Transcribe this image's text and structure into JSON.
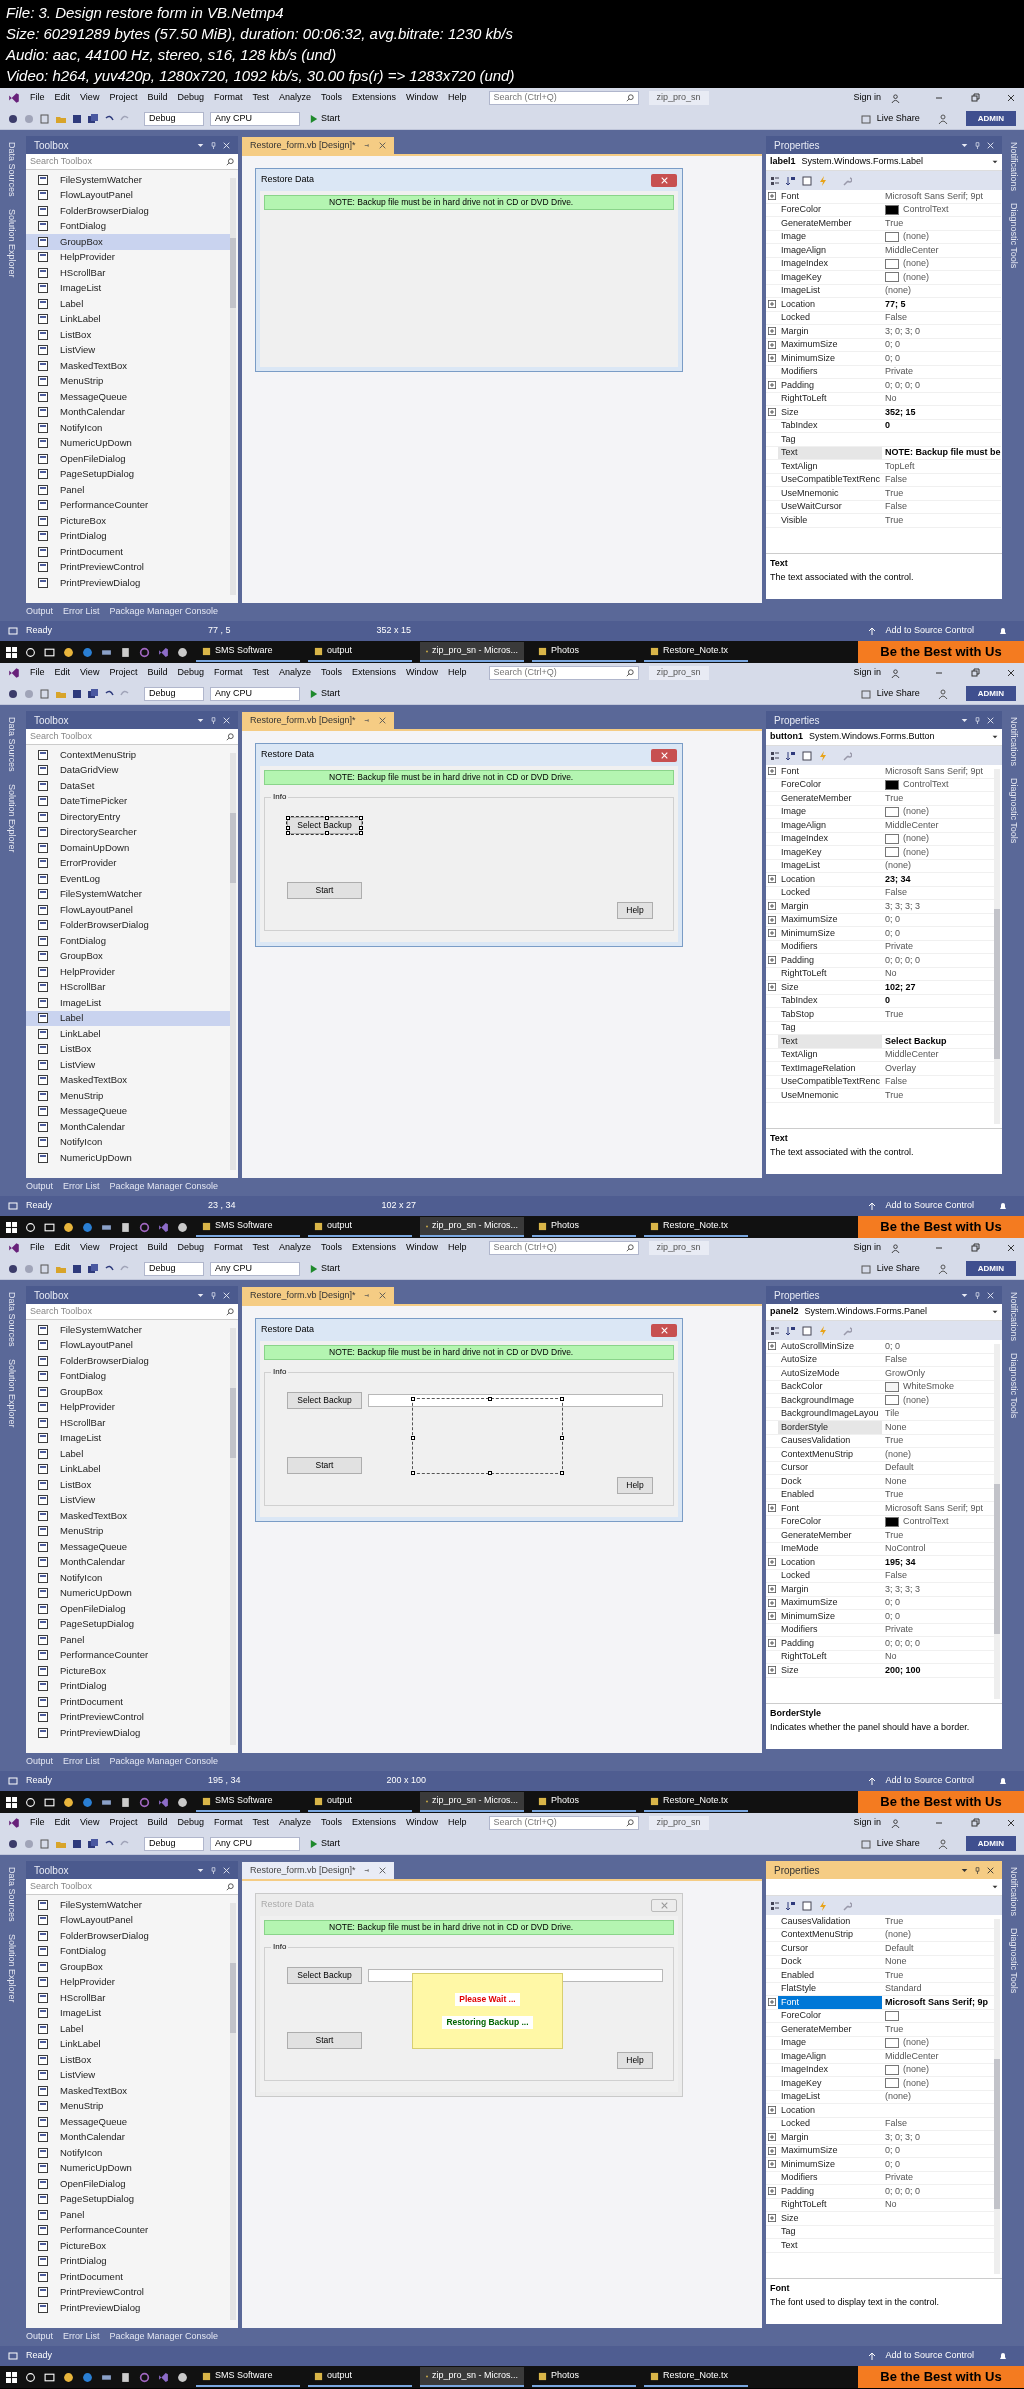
{
  "header": {
    "lines": [
      "File: 3. Design restore form in VB.Netmp4",
      "Size: 60291289 bytes (57.50 MiB), duration: 00:06:32, avg.bitrate: 1230 kb/s",
      "Audio: aac, 44100 Hz, stereo, s16, 128 kb/s (und)",
      "Video: h264, yuv420p, 1280x720, 1092 kb/s, 30.00 fps(r) => 1283x720 (und)"
    ]
  },
  "frames": [
    {
      "menu": [
        "File",
        "Edit",
        "View",
        "Project",
        "Build",
        "Debug",
        "Format",
        "Test",
        "Analyze",
        "Tools",
        "Extensions",
        "Window",
        "Help"
      ],
      "search_placeholder": "Search (Ctrl+Q)",
      "solution": "zip_pro_sn",
      "sign_in": "Sign in",
      "toolbar": {
        "config": "Debug",
        "platform": "Any CPU",
        "run": "Start",
        "live_share": "Live Share",
        "user": "ADMIN"
      },
      "left_tabs": [
        "Data Sources",
        "Solution Explorer"
      ],
      "right_tabs": [
        "Notifications",
        "Diagnostic Tools"
      ],
      "toolbox": {
        "title": "Toolbox",
        "search_placeholder": "Search Toolbox",
        "items": [
          {
            "label": "FileSystemWatcher",
            "selected": false
          },
          {
            "label": "FlowLayoutPanel",
            "selected": false
          },
          {
            "label": "FolderBrowserDialog",
            "selected": false
          },
          {
            "label": "FontDialog",
            "selected": false
          },
          {
            "label": "GroupBox",
            "selected": true
          },
          {
            "label": "HelpProvider",
            "selected": false
          },
          {
            "label": "HScrollBar",
            "selected": false
          },
          {
            "label": "ImageList",
            "selected": false
          },
          {
            "label": "Label",
            "selected": false
          },
          {
            "label": "LinkLabel",
            "selected": false
          },
          {
            "label": "ListBox",
            "selected": false
          },
          {
            "label": "ListView",
            "selected": false
          },
          {
            "label": "MaskedTextBox",
            "selected": false
          },
          {
            "label": "MenuStrip",
            "selected": false
          },
          {
            "label": "MessageQueue",
            "selected": false
          },
          {
            "label": "MonthCalendar",
            "selected": false
          },
          {
            "label": "NotifyIcon",
            "selected": false
          },
          {
            "label": "NumericUpDown",
            "selected": false
          },
          {
            "label": "OpenFileDialog",
            "selected": false
          },
          {
            "label": "PageSetupDialog",
            "selected": false
          },
          {
            "label": "Panel",
            "selected": false
          },
          {
            "label": "PerformanceCounter",
            "selected": false
          },
          {
            "label": "PictureBox",
            "selected": false
          },
          {
            "label": "PrintDialog",
            "selected": false
          },
          {
            "label": "PrintDocument",
            "selected": false
          },
          {
            "label": "PrintPreviewControl",
            "selected": false
          },
          {
            "label": "PrintPreviewDialog",
            "selected": false
          }
        ]
      },
      "document_tab": {
        "label": "Restore_form.vb [Design]*",
        "active": true
      },
      "form": {
        "title": "Restore Data",
        "active": true,
        "note": "NOTE: Backup file must be in hard drive not in CD or DVD Drive."
      },
      "properties": {
        "title": "Properties",
        "active": false,
        "object_name": "label1",
        "object_type": "System.Windows.Forms.Label",
        "rows": [
          {
            "name": "Font",
            "value": "Microsoft Sans Serif; 9pt",
            "expandable": true,
            "bold": false,
            "selected": false
          },
          {
            "name": "ForeColor",
            "value": "ControlText",
            "color": "#000000",
            "expandable": false,
            "bold": false,
            "selected": false
          },
          {
            "name": "GenerateMember",
            "value": "True",
            "expandable": false,
            "bold": false,
            "selected": false
          },
          {
            "name": "Image",
            "value": "(none)",
            "color": "#ffffff",
            "expandable": false,
            "bold": false,
            "selected": false
          },
          {
            "name": "ImageAlign",
            "value": "MiddleCenter",
            "expandable": false,
            "bold": false,
            "selected": false
          },
          {
            "name": "ImageIndex",
            "value": "(none)",
            "color": "#ffffff",
            "expandable": false,
            "bold": false,
            "selected": false
          },
          {
            "name": "ImageKey",
            "value": "(none)",
            "color": "#ffffff",
            "expandable": false,
            "bold": false,
            "selected": false
          },
          {
            "name": "ImageList",
            "value": "(none)",
            "expandable": false,
            "bold": false,
            "selected": false
          },
          {
            "name": "Location",
            "value": "77; 5",
            "expandable": true,
            "bold": true,
            "selected": false
          },
          {
            "name": "Locked",
            "value": "False",
            "expandable": false,
            "bold": false,
            "selected": false
          },
          {
            "name": "Margin",
            "value": "3; 0; 3; 0",
            "expandable": true,
            "bold": false,
            "selected": false
          },
          {
            "name": "MaximumSize",
            "value": "0; 0",
            "expandable": true,
            "bold": false,
            "selected": false
          },
          {
            "name": "MinimumSize",
            "value": "0; 0",
            "expandable": true,
            "bold": false,
            "selected": false
          },
          {
            "name": "Modifiers",
            "value": "Private",
            "expandable": false,
            "bold": false,
            "selected": false
          },
          {
            "name": "Padding",
            "value": "0; 0; 0; 0",
            "expandable": true,
            "bold": false,
            "selected": false
          },
          {
            "name": "RightToLeft",
            "value": "No",
            "expandable": false,
            "bold": false,
            "selected": false
          },
          {
            "name": "Size",
            "value": "352; 15",
            "expandable": true,
            "bold": true,
            "selected": false
          },
          {
            "name": "TabIndex",
            "value": "0",
            "expandable": false,
            "bold": true,
            "selected": false
          },
          {
            "name": "Tag",
            "expandable": false,
            "selected": false
          },
          {
            "name": "Text",
            "value": "NOTE: Backup file must be",
            "expandable": false,
            "bold": true,
            "selected": true
          },
          {
            "name": "TextAlign",
            "value": "TopLeft",
            "expandable": false,
            "bold": false,
            "selected": false
          },
          {
            "name": "UseCompatibleTextRenc",
            "value": "False",
            "expandable": false,
            "bold": false,
            "selected": false
          },
          {
            "name": "UseMnemonic",
            "value": "True",
            "expandable": false,
            "bold": false,
            "selected": false
          },
          {
            "name": "UseWaitCursor",
            "value": "False",
            "expandable": false,
            "bold": false,
            "selected": false
          },
          {
            "name": "Visible",
            "value": "True",
            "expandable": false,
            "bold": false,
            "selected": false
          }
        ],
        "description_title": "Text",
        "description": "The text associated with the control."
      },
      "bottom_tabs": [
        "Output",
        "Error List",
        "Package Manager Console"
      ],
      "status": {
        "text": "Ready",
        "position": "77 , 5",
        "size": "352 x 15",
        "source_control": "Add to Source Control"
      },
      "taskbar": [
        {
          "label": "SMS Software",
          "selected": false
        },
        {
          "label": "output",
          "selected": false
        },
        {
          "label": "zip_pro_sn - Micros...",
          "selected": true
        },
        {
          "label": "Photos",
          "selected": false
        },
        {
          "label": "Restore_Note.tx",
          "selected": false
        }
      ],
      "banner": "Be the Best with Us"
    },
    {
      "menu": [
        "File",
        "Edit",
        "View",
        "Project",
        "Build",
        "Debug",
        "Format",
        "Test",
        "Analyze",
        "Tools",
        "Extensions",
        "Window",
        "Help"
      ],
      "search_placeholder": "Search (Ctrl+Q)",
      "solution": "zip_pro_sn",
      "sign_in": "Sign in",
      "toolbar": {
        "config": "Debug",
        "platform": "Any CPU",
        "run": "Start",
        "live_share": "Live Share",
        "user": "ADMIN"
      },
      "left_tabs": [
        "Data Sources",
        "Solution Explorer"
      ],
      "right_tabs": [
        "Notifications",
        "Diagnostic Tools"
      ],
      "toolbox": {
        "title": "Toolbox",
        "search_placeholder": "Search Toolbox",
        "items": [
          {
            "label": "ContextMenuStrip",
            "selected": false
          },
          {
            "label": "DataGridView",
            "selected": false
          },
          {
            "label": "DataSet",
            "selected": false
          },
          {
            "label": "DateTimePicker",
            "selected": false
          },
          {
            "label": "DirectoryEntry",
            "selected": false
          },
          {
            "label": "DirectorySearcher",
            "selected": false
          },
          {
            "label": "DomainUpDown",
            "selected": false
          },
          {
            "label": "ErrorProvider",
            "selected": false
          },
          {
            "label": "EventLog",
            "selected": false
          },
          {
            "label": "FileSystemWatcher",
            "selected": false
          },
          {
            "label": "FlowLayoutPanel",
            "selected": false
          },
          {
            "label": "FolderBrowserDialog",
            "selected": false
          },
          {
            "label": "FontDialog",
            "selected": false
          },
          {
            "label": "GroupBox",
            "selected": false
          },
          {
            "label": "HelpProvider",
            "selected": false
          },
          {
            "label": "HScrollBar",
            "selected": false
          },
          {
            "label": "ImageList",
            "selected": false
          },
          {
            "label": "Label",
            "selected": true
          },
          {
            "label": "LinkLabel",
            "selected": false
          },
          {
            "label": "ListBox",
            "selected": false
          },
          {
            "label": "ListView",
            "selected": false
          },
          {
            "label": "MaskedTextBox",
            "selected": false
          },
          {
            "label": "MenuStrip",
            "selected": false
          },
          {
            "label": "MessageQueue",
            "selected": false
          },
          {
            "label": "MonthCalendar",
            "selected": false
          },
          {
            "label": "NotifyIcon",
            "selected": false
          },
          {
            "label": "NumericUpDown",
            "selected": false
          }
        ]
      },
      "document_tab": {
        "label": "Restore_form.vb [Design]*",
        "active": true
      },
      "form": {
        "title": "Restore Data",
        "active": true,
        "note": "NOTE: Backup file must be in hard drive not in CD or DVD Drive.",
        "group": "Info",
        "select_button": {
          "label": "Select Backup",
          "selected": true
        },
        "start_button": "Start",
        "help_button": "Help"
      },
      "properties": {
        "title": "Properties",
        "active": false,
        "object_name": "button1",
        "object_type": "System.Windows.Forms.Button",
        "rows": [
          {
            "name": "Font",
            "value": "Microsoft Sans Serif; 9pt",
            "expandable": true,
            "bold": false,
            "selected": false
          },
          {
            "name": "ForeColor",
            "value": "ControlText",
            "color": "#000000",
            "expandable": false,
            "bold": false,
            "selected": false
          },
          {
            "name": "GenerateMember",
            "value": "True",
            "expandable": false,
            "bold": false,
            "selected": false
          },
          {
            "name": "Image",
            "value": "(none)",
            "color": "#ffffff",
            "expandable": false,
            "bold": false,
            "selected": false
          },
          {
            "name": "ImageAlign",
            "value": "MiddleCenter",
            "expandable": false,
            "bold": false,
            "selected": false
          },
          {
            "name": "ImageIndex",
            "value": "(none)",
            "color": "#ffffff",
            "expandable": false,
            "bold": false,
            "selected": false
          },
          {
            "name": "ImageKey",
            "value": "(none)",
            "color": "#ffffff",
            "expandable": false,
            "bold": false,
            "selected": false
          },
          {
            "name": "ImageList",
            "value": "(none)",
            "expandable": false,
            "bold": false,
            "selected": false
          },
          {
            "name": "Location",
            "value": "23; 34",
            "expandable": true,
            "bold": true,
            "selected": false
          },
          {
            "name": "Locked",
            "value": "False",
            "expandable": false,
            "bold": false,
            "selected": false
          },
          {
            "name": "Margin",
            "value": "3; 3; 3; 3",
            "expandable": true,
            "bold": false,
            "selected": false
          },
          {
            "name": "MaximumSize",
            "value": "0; 0",
            "expandable": true,
            "bold": false,
            "selected": false
          },
          {
            "name": "MinimumSize",
            "value": "0; 0",
            "expandable": true,
            "bold": false,
            "selected": false
          },
          {
            "name": "Modifiers",
            "value": "Private",
            "expandable": false,
            "bold": false,
            "selected": false
          },
          {
            "name": "Padding",
            "value": "0; 0; 0; 0",
            "expandable": true,
            "bold": false,
            "selected": false
          },
          {
            "name": "RightToLeft",
            "value": "No",
            "expandable": false,
            "bold": false,
            "selected": false
          },
          {
            "name": "Size",
            "value": "102; 27",
            "expandable": true,
            "bold": true,
            "selected": false
          },
          {
            "name": "TabIndex",
            "value": "0",
            "expandable": false,
            "bold": true,
            "selected": false
          },
          {
            "name": "TabStop",
            "value": "True",
            "expandable": false,
            "bold": false,
            "selected": false
          },
          {
            "name": "Tag",
            "expandable": false,
            "selected": false
          },
          {
            "name": "Text",
            "value": "Select Backup",
            "expandable": false,
            "bold": true,
            "selected": true
          },
          {
            "name": "TextAlign",
            "value": "MiddleCenter",
            "expandable": false,
            "bold": false,
            "selected": false
          },
          {
            "name": "TextImageRelation",
            "value": "Overlay",
            "expandable": false,
            "bold": false,
            "selected": false
          },
          {
            "name": "UseCompatibleTextRenc",
            "value": "False",
            "expandable": false,
            "bold": false,
            "selected": false
          },
          {
            "name": "UseMnemonic",
            "value": "True",
            "expandable": false,
            "bold": false,
            "selected": false
          }
        ],
        "description_title": "Text",
        "description": "The text associated with the control."
      },
      "bottom_tabs": [
        "Output",
        "Error List",
        "Package Manager Console"
      ],
      "status": {
        "text": "Ready",
        "position": "23 , 34",
        "size": "102 x 27",
        "source_control": "Add to Source Control"
      },
      "taskbar": [
        {
          "label": "SMS Software",
          "selected": false
        },
        {
          "label": "output",
          "selected": false
        },
        {
          "label": "zip_pro_sn - Micros...",
          "selected": true
        },
        {
          "label": "Photos",
          "selected": false
        },
        {
          "label": "Restore_Note.tx",
          "selected": false
        }
      ],
      "banner": "Be the Best with Us"
    },
    {
      "menu": [
        "File",
        "Edit",
        "View",
        "Project",
        "Build",
        "Debug",
        "Format",
        "Test",
        "Analyze",
        "Tools",
        "Extensions",
        "Window",
        "Help"
      ],
      "search_placeholder": "Search (Ctrl+Q)",
      "solution": "zip_pro_sn",
      "sign_in": "Sign in",
      "toolbar": {
        "config": "Debug",
        "platform": "Any CPU",
        "run": "Start",
        "live_share": "Live Share",
        "user": "ADMIN"
      },
      "left_tabs": [
        "Data Sources",
        "Solution Explorer"
      ],
      "right_tabs": [
        "Notifications",
        "Diagnostic Tools"
      ],
      "toolbox": {
        "title": "Toolbox",
        "search_placeholder": "Search Toolbox",
        "items": [
          {
            "label": "FileSystemWatcher",
            "selected": false
          },
          {
            "label": "FlowLayoutPanel",
            "selected": false
          },
          {
            "label": "FolderBrowserDialog",
            "selected": false
          },
          {
            "label": "FontDialog",
            "selected": false
          },
          {
            "label": "GroupBox",
            "selected": false
          },
          {
            "label": "HelpProvider",
            "selected": false
          },
          {
            "label": "HScrollBar",
            "selected": false
          },
          {
            "label": "ImageList",
            "selected": false
          },
          {
            "label": "Label",
            "selected": false
          },
          {
            "label": "LinkLabel",
            "selected": false
          },
          {
            "label": "ListBox",
            "selected": false
          },
          {
            "label": "ListView",
            "selected": false
          },
          {
            "label": "MaskedTextBox",
            "selected": false
          },
          {
            "label": "MenuStrip",
            "selected": false
          },
          {
            "label": "MessageQueue",
            "selected": false
          },
          {
            "label": "MonthCalendar",
            "selected": false
          },
          {
            "label": "NotifyIcon",
            "selected": false
          },
          {
            "label": "NumericUpDown",
            "selected": false
          },
          {
            "label": "OpenFileDialog",
            "selected": false
          },
          {
            "label": "PageSetupDialog",
            "selected": false
          },
          {
            "label": "Panel",
            "selected": false
          },
          {
            "label": "PerformanceCounter",
            "selected": false
          },
          {
            "label": "PictureBox",
            "selected": false
          },
          {
            "label": "PrintDialog",
            "selected": false
          },
          {
            "label": "PrintDocument",
            "selected": false
          },
          {
            "label": "PrintPreviewControl",
            "selected": false
          },
          {
            "label": "PrintPreviewDialog",
            "selected": false
          }
        ]
      },
      "document_tab": {
        "label": "Restore_form.vb [Design]*",
        "active": true
      },
      "form": {
        "title": "Restore Data",
        "active": true,
        "note": "NOTE: Backup file must be in hard drive not in CD or DVD Drive.",
        "group": "Info",
        "select_button": {
          "label": "Select Backup",
          "selected": false
        },
        "textbox": true,
        "panel": {
          "selected": true
        },
        "start_button": "Start",
        "help_button": "Help"
      },
      "properties": {
        "title": "Properties",
        "active": false,
        "object_name": "panel2",
        "object_type": "System.Windows.Forms.Panel",
        "rows": [
          {
            "name": "AutoScrollMinSize",
            "value": "0; 0",
            "expandable": true,
            "bold": false,
            "selected": false
          },
          {
            "name": "AutoSize",
            "value": "False",
            "expandable": false,
            "bold": false,
            "selected": false
          },
          {
            "name": "AutoSizeMode",
            "value": "GrowOnly",
            "expandable": false,
            "bold": false,
            "selected": false
          },
          {
            "name": "BackColor",
            "value": "WhiteSmoke",
            "color": "#f5f5f5",
            "expandable": false,
            "bold": false,
            "selected": false
          },
          {
            "name": "BackgroundImage",
            "value": "(none)",
            "color": "#ffffff",
            "expandable": false,
            "bold": false,
            "selected": false
          },
          {
            "name": "BackgroundImageLayou",
            "value": "Tile",
            "expandable": false,
            "bold": false,
            "selected": false
          },
          {
            "name": "BorderStyle",
            "value": "None",
            "expandable": false,
            "bold": false,
            "selected": true
          },
          {
            "name": "CausesValidation",
            "value": "True",
            "expandable": false,
            "bold": false,
            "selected": false
          },
          {
            "name": "ContextMenuStrip",
            "value": "(none)",
            "expandable": false,
            "bold": false,
            "selected": false
          },
          {
            "name": "Cursor",
            "value": "Default",
            "expandable": false,
            "bold": false,
            "selected": false
          },
          {
            "name": "Dock",
            "value": "None",
            "expandable": false,
            "bold": false,
            "selected": false
          },
          {
            "name": "Enabled",
            "value": "True",
            "expandable": false,
            "bold": false,
            "selected": false
          },
          {
            "name": "Font",
            "value": "Microsoft Sans Serif; 9pt",
            "expandable": true,
            "bold": false,
            "selected": false
          },
          {
            "name": "ForeColor",
            "value": "ControlText",
            "color": "#000000",
            "expandable": false,
            "bold": false,
            "selected": false
          },
          {
            "name": "GenerateMember",
            "value": "True",
            "expandable": false,
            "bold": false,
            "selected": false
          },
          {
            "name": "ImeMode",
            "value": "NoControl",
            "expandable": false,
            "bold": false,
            "selected": false
          },
          {
            "name": "Location",
            "value": "195; 34",
            "expandable": true,
            "bold": true,
            "selected": false
          },
          {
            "name": "Locked",
            "value": "False",
            "expandable": false,
            "bold": false,
            "selected": false
          },
          {
            "name": "Margin",
            "value": "3; 3; 3; 3",
            "expandable": true,
            "bold": false,
            "selected": false
          },
          {
            "name": "MaximumSize",
            "value": "0; 0",
            "expandable": true,
            "bold": false,
            "selected": false
          },
          {
            "name": "MinimumSize",
            "value": "0; 0",
            "expandable": true,
            "bold": false,
            "selected": false
          },
          {
            "name": "Modifiers",
            "value": "Private",
            "expandable": false,
            "bold": false,
            "selected": false
          },
          {
            "name": "Padding",
            "value": "0; 0; 0; 0",
            "expandable": true,
            "bold": false,
            "selected": false
          },
          {
            "name": "RightToLeft",
            "value": "No",
            "expandable": false,
            "bold": false,
            "selected": false
          },
          {
            "name": "Size",
            "value": "200; 100",
            "expandable": true,
            "bold": true,
            "selected": false
          }
        ],
        "description_title": "BorderStyle",
        "description": "Indicates whether the panel should have a border."
      },
      "bottom_tabs": [
        "Output",
        "Error List",
        "Package Manager Console"
      ],
      "status": {
        "text": "Ready",
        "position": "195 , 34",
        "size": "200 x 100",
        "source_control": "Add to Source Control"
      },
      "taskbar": [
        {
          "label": "SMS Software",
          "selected": false
        },
        {
          "label": "output",
          "selected": false
        },
        {
          "label": "zip_pro_sn - Micros...",
          "selected": true
        },
        {
          "label": "Photos",
          "selected": false
        },
        {
          "label": "Restore_Note.tx",
          "selected": false
        }
      ],
      "banner": "Be the Best with Us"
    },
    {
      "menu": [
        "File",
        "Edit",
        "View",
        "Project",
        "Build",
        "Debug",
        "Format",
        "Test",
        "Analyze",
        "Tools",
        "Extensions",
        "Window",
        "Help"
      ],
      "search_placeholder": "Search (Ctrl+Q)",
      "solution": "zip_pro_sn",
      "sign_in": "Sign in",
      "toolbar": {
        "config": "Debug",
        "platform": "Any CPU",
        "run": "Start",
        "live_share": "Live Share",
        "user": "ADMIN"
      },
      "left_tabs": [
        "Data Sources",
        "Solution Explorer"
      ],
      "right_tabs": [
        "Notifications",
        "Diagnostic Tools"
      ],
      "toolbox": {
        "title": "Toolbox",
        "search_placeholder": "Search Toolbox",
        "items": [
          {
            "label": "FileSystemWatcher",
            "selected": false
          },
          {
            "label": "FlowLayoutPanel",
            "selected": false
          },
          {
            "label": "FolderBrowserDialog",
            "selected": false
          },
          {
            "label": "FontDialog",
            "selected": false
          },
          {
            "label": "GroupBox",
            "selected": false
          },
          {
            "label": "HelpProvider",
            "selected": false
          },
          {
            "label": "HScrollBar",
            "selected": false
          },
          {
            "label": "ImageList",
            "selected": false
          },
          {
            "label": "Label",
            "selected": false
          },
          {
            "label": "LinkLabel",
            "selected": false
          },
          {
            "label": "ListBox",
            "selected": false
          },
          {
            "label": "ListView",
            "selected": false
          },
          {
            "label": "MaskedTextBox",
            "selected": false
          },
          {
            "label": "MenuStrip",
            "selected": false
          },
          {
            "label": "MessageQueue",
            "selected": false
          },
          {
            "label": "MonthCalendar",
            "selected": false
          },
          {
            "label": "NotifyIcon",
            "selected": false
          },
          {
            "label": "NumericUpDown",
            "selected": false
          },
          {
            "label": "OpenFileDialog",
            "selected": false
          },
          {
            "label": "PageSetupDialog",
            "selected": false
          },
          {
            "label": "Panel",
            "selected": false
          },
          {
            "label": "PerformanceCounter",
            "selected": false
          },
          {
            "label": "PictureBox",
            "selected": false
          },
          {
            "label": "PrintDialog",
            "selected": false
          },
          {
            "label": "PrintDocument",
            "selected": false
          },
          {
            "label": "PrintPreviewControl",
            "selected": false
          },
          {
            "label": "PrintPreviewDialog",
            "selected": false
          }
        ]
      },
      "document_tab": {
        "label": "Restore_form.vb [Design]*",
        "active": false
      },
      "form": {
        "title": "Restore Data",
        "active": false,
        "note": "NOTE: Backup file must be in hard drive not in CD or DVD Drive.",
        "group": "Info",
        "select_button": {
          "label": "Select Backup",
          "selected": false
        },
        "textbox": true,
        "panel": {
          "selected": false,
          "labels": [
            {
              "text": "Please Wait ...",
              "color": "#e00000"
            },
            {
              "text": "Restoring Backup ...",
              "color": "#006400"
            }
          ]
        },
        "start_button": "Start",
        "help_button": "Help"
      },
      "properties": {
        "title": "Properties",
        "active": true,
        "rows": [
          {
            "name": "CausesValidation",
            "value": "True",
            "expandable": false,
            "bold": false,
            "selected": false
          },
          {
            "name": "ContextMenuStrip",
            "value": "(none)",
            "expandable": false,
            "bold": false,
            "selected": false
          },
          {
            "name": "Cursor",
            "value": "Default",
            "expandable": false,
            "bold": false,
            "selected": false
          },
          {
            "name": "Dock",
            "value": "None",
            "expandable": false,
            "bold": false,
            "selected": false
          },
          {
            "name": "Enabled",
            "value": "True",
            "expandable": false,
            "bold": false,
            "selected": false
          },
          {
            "name": "FlatStyle",
            "value": "Standard",
            "expandable": false,
            "bold": false,
            "selected": false
          },
          {
            "name": "Font",
            "value": "Microsoft Sans Serif; 9p",
            "expandable": true,
            "bold": true,
            "selected": true
          },
          {
            "name": "ForeColor",
            "color": "#ffffff",
            "expandable": false,
            "selected": false
          },
          {
            "name": "GenerateMember",
            "value": "True",
            "expandable": false,
            "bold": false,
            "selected": false
          },
          {
            "name": "Image",
            "value": "(none)",
            "color": "#ffffff",
            "expandable": false,
            "bold": false,
            "selected": false
          },
          {
            "name": "ImageAlign",
            "value": "MiddleCenter",
            "expandable": false,
            "bold": false,
            "selected": false
          },
          {
            "name": "ImageIndex",
            "value": "(none)",
            "color": "#ffffff",
            "expandable": false,
            "bold": false,
            "selected": false
          },
          {
            "name": "ImageKey",
            "value": "(none)",
            "color": "#ffffff",
            "expandable": false,
            "bold": false,
            "selected": false
          },
          {
            "name": "ImageList",
            "value": "(none)",
            "expandable": false,
            "bold": false,
            "selected": false
          },
          {
            "name": "Location",
            "expandable": true,
            "selected": false
          },
          {
            "name": "Locked",
            "value": "False",
            "expandable": false,
            "bold": false,
            "selected": false
          },
          {
            "name": "Margin",
            "value": "3; 0; 3; 0",
            "expandable": true,
            "bold": false,
            "selected": false
          },
          {
            "name": "MaximumSize",
            "value": "0; 0",
            "expandable": true,
            "bold": false,
            "selected": false
          },
          {
            "name": "MinimumSize",
            "value": "0; 0",
            "expandable": true,
            "bold": false,
            "selected": false
          },
          {
            "name": "Modifiers",
            "value": "Private",
            "expandable": false,
            "bold": false,
            "selected": false
          },
          {
            "name": "Padding",
            "value": "0; 0; 0; 0",
            "expandable": true,
            "bold": false,
            "selected": false
          },
          {
            "name": "RightToLeft",
            "value": "No",
            "expandable": false,
            "bold": false,
            "selected": false
          },
          {
            "name": "Size",
            "expandable": true,
            "selected": false
          },
          {
            "name": "Tag",
            "expandable": false,
            "selected": false
          },
          {
            "name": "Text",
            "expandable": false,
            "selected": false
          }
        ],
        "description_title": "Font",
        "description": "The font used to display text in the control."
      },
      "bottom_tabs": [
        "Output",
        "Error List",
        "Package Manager Console"
      ],
      "status": {
        "text": "Ready",
        "source_control": "Add to Source Control"
      },
      "taskbar": [
        {
          "label": "SMS Software",
          "selected": false
        },
        {
          "label": "output",
          "selected": false
        },
        {
          "label": "zip_pro_sn - Micros...",
          "selected": true
        },
        {
          "label": "Photos",
          "selected": false
        },
        {
          "label": "Restore_Note.tx",
          "selected": false
        }
      ],
      "banner": "Be the Best with Us"
    }
  ]
}
